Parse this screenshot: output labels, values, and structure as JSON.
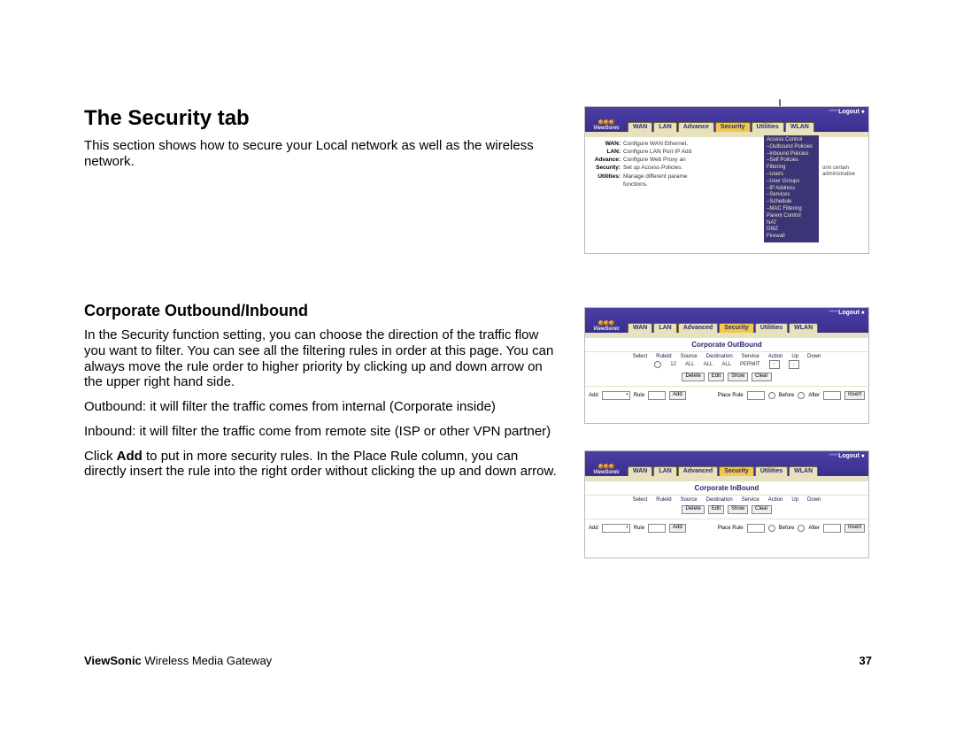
{
  "doc": {
    "heading1": "The Security tab",
    "intro": "This section shows how to secure your Local network as well as the wireless network.",
    "heading2": "Corporate Outbound/Inbound",
    "p1": "In the Security function setting, you can choose the direction of the traffic flow you want to filter.  You can see all the filtering rules in order at this page.  You can always move the rule order to higher priority by clicking up and down arrow on the upper right hand side.",
    "p2": "Outbound: it will filter the traffic comes from internal (Corporate inside)",
    "p3": "Inbound: it will filter the traffic come from remote site (ISP or other VPN partner)",
    "p4_pre": "Click ",
    "p4_bold": "Add",
    "p4_post": " to put in more security rules.  In the Place Rule column, you can directly insert the rule into the right order without clicking the up and down arrow.",
    "footer_brand": "ViewSonic",
    "footer_rest": " Wireless Media Gateway",
    "page_num": "37"
  },
  "arrow": "↓",
  "ui": {
    "brand": "ViewSonic",
    "logout": "Logout ●",
    "tabs1": [
      "WAN",
      "LAN",
      "Advance",
      "Security",
      "Utilities",
      "WLAN"
    ],
    "tabs2": [
      "WAN",
      "LAN",
      "Advanced",
      "Security",
      "Utilities",
      "WLAN"
    ],
    "pane1": {
      "rows": [
        {
          "k": "WAN:",
          "v": "Configure WAN Ethernet."
        },
        {
          "k": "LAN:",
          "v": "Configure LAN Port IP Add"
        },
        {
          "k": "Advance:",
          "v": "Configure Web Proxy an"
        },
        {
          "k": "Security:",
          "v": "Set up Access Policies."
        },
        {
          "k": "Utilities:",
          "v": "Manage different parame"
        }
      ],
      "utilities_line2": "functions.",
      "right_note": "orm certain administrative",
      "menu": [
        "Access Control",
        "–Outbound Policies",
        "–Inbound Policies",
        "–Self Policies",
        "Filtering",
        "–Users",
        "–User Groups",
        "–IP Address",
        "–Services",
        "–Schedule",
        "–MAC Filtering",
        "Parent Control",
        "NAT",
        "DMZ",
        "Firewall"
      ]
    },
    "pane2": {
      "title": "Corporate OutBound",
      "head": [
        "Select",
        "RuleId",
        "Source",
        "Destination",
        "Service",
        "Action",
        "Up",
        "Down"
      ],
      "row": {
        "id": "12",
        "src": "ALL",
        "dst": "ALL",
        "svc": "ALL",
        "act": "PERMIT"
      },
      "btns": [
        "Delete",
        "Edit",
        "Show",
        "Clear"
      ],
      "add_label": "Add",
      "rule_label": "Rule",
      "add_btn": "Add",
      "place_label": "Place Rule",
      "before": "Before",
      "after": "After",
      "insert": "Insert"
    },
    "pane3": {
      "title": "Corporate InBound",
      "head": [
        "Select",
        "RuleId",
        "Source",
        "Destination",
        "Service",
        "Action",
        "Up",
        "Down"
      ],
      "btns": [
        "Delete",
        "Edit",
        "Show",
        "Clear"
      ],
      "add_label": "Add",
      "rule_label": "Rule",
      "add_btn": "Add",
      "place_label": "Place Rule",
      "before": "Before",
      "after": "After",
      "insert": "Insert"
    }
  }
}
